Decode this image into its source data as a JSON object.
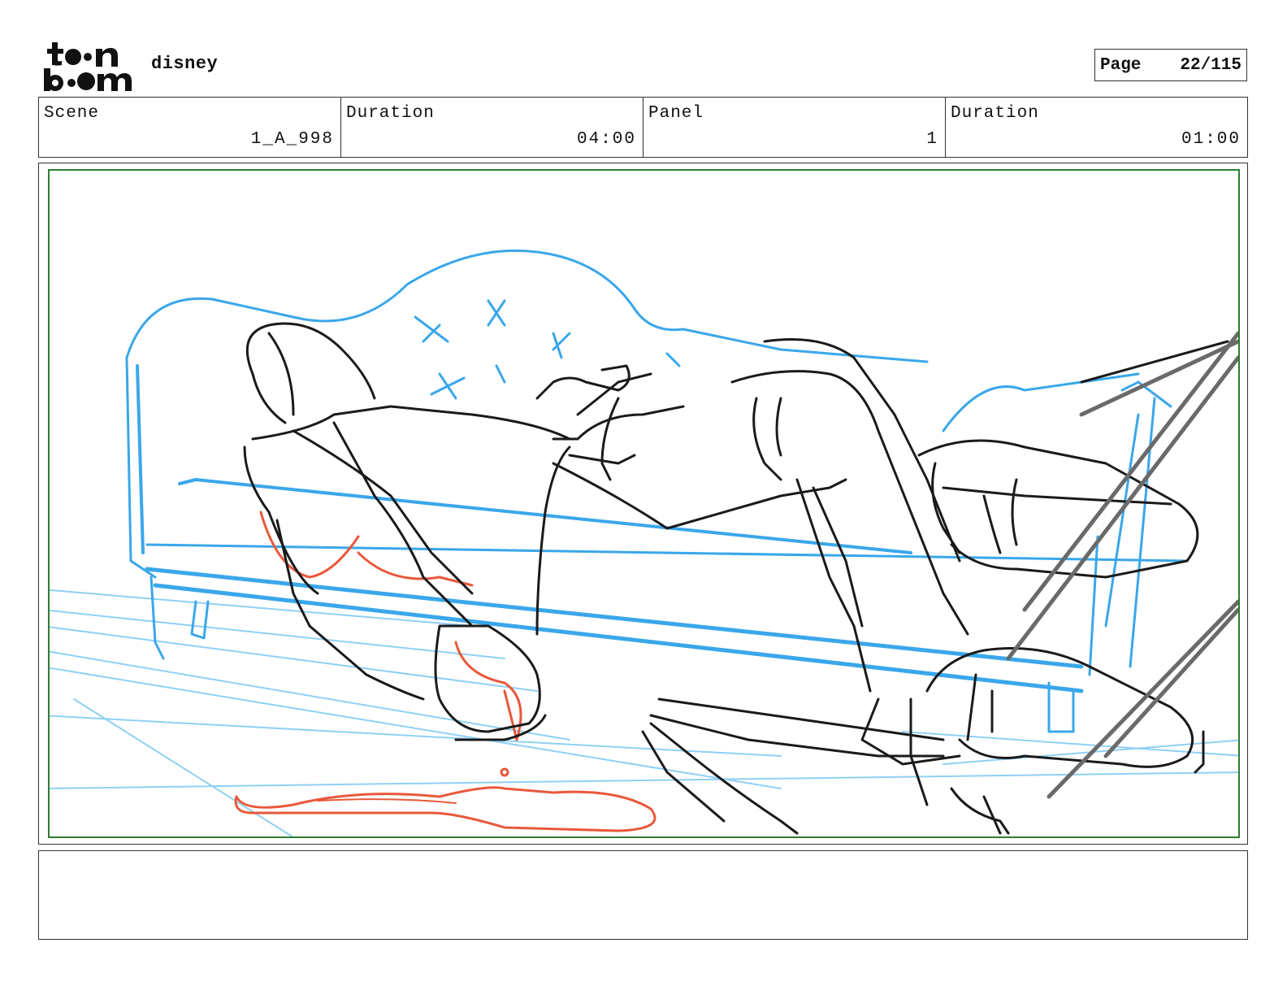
{
  "header": {
    "logo_text": "toon boom",
    "project": "disney",
    "page_label": "Page",
    "page_value": "22/115"
  },
  "info": [
    {
      "label": "Scene",
      "value": "1_A_998"
    },
    {
      "label": "Duration",
      "value": "04:00"
    },
    {
      "label": "Panel",
      "value": "1"
    },
    {
      "label": "Duration",
      "value": "01:00"
    }
  ],
  "panel": {
    "frame_color": "#2e7d32",
    "sketch_colors": {
      "layout": "#3aa7ea",
      "character": "#1a1a1a",
      "blood": "#e8583a"
    }
  },
  "notes": {
    "text": ""
  }
}
